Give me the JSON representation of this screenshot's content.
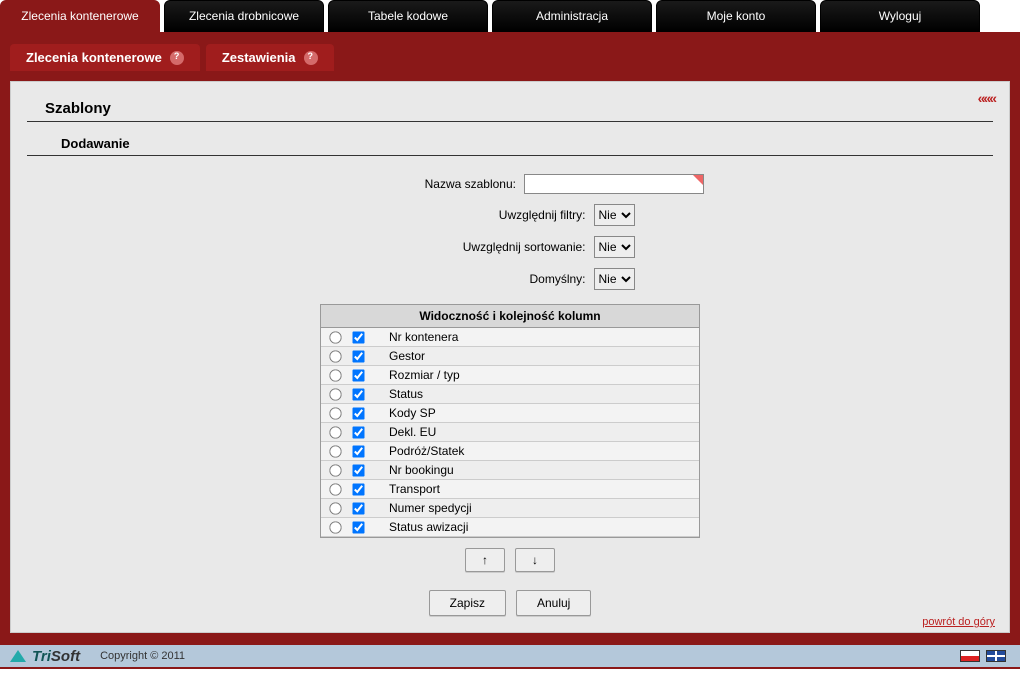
{
  "topTabs": {
    "kontenerowe": "Zlecenia kontenerowe",
    "drobnicowe": "Zlecenia drobnicowe",
    "tabele": "Tabele kodowe",
    "admin": "Administracja",
    "konto": "Moje konto",
    "wyloguj": "Wyloguj"
  },
  "subtabs": {
    "kontenerowe": "Zlecenia kontenerowe",
    "zestawienia": "Zestawienia"
  },
  "titles": {
    "szablony": "Szablony",
    "dodawanie": "Dodawanie"
  },
  "form": {
    "nazwa_label": "Nazwa szablonu:",
    "filtry_label": "Uwzględnij filtry:",
    "sort_label": "Uwzględnij sortowanie:",
    "domyslny_label": "Domyślny:",
    "option_nie": "Nie"
  },
  "colTable": {
    "header": "Widoczność i kolejność kolumn",
    "rows": [
      "Nr kontenera",
      "Gestor",
      "Rozmiar / typ",
      "Status",
      "Kody SP",
      "Dekl. EU",
      "Podróż/Statek",
      "Nr bookingu",
      "Transport",
      "Numer spedycji",
      "Status awizacji"
    ]
  },
  "buttons": {
    "up": "↑",
    "down": "↓",
    "save": "Zapisz",
    "cancel": "Anuluj"
  },
  "links": {
    "back_top": "powrót do góry"
  },
  "footer": {
    "brand_tri": "Tri",
    "brand_soft": "Soft",
    "copyright": "Copyright © 2011"
  }
}
